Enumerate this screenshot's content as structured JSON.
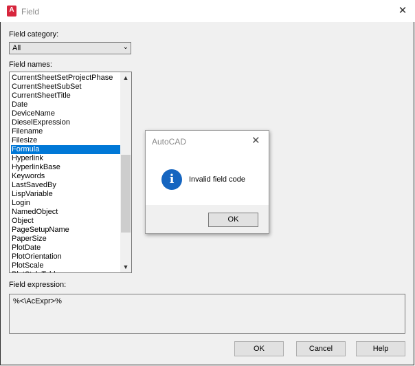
{
  "window": {
    "title": "Field",
    "app_icon_letter": "A"
  },
  "field_category": {
    "label": "Field category:",
    "selected": "All"
  },
  "field_names": {
    "label": "Field names:",
    "items": [
      "CurrentSheetSetProjectPhase",
      "CurrentSheetSubSet",
      "CurrentSheetTitle",
      "Date",
      "DeviceName",
      "DieselExpression",
      "Filename",
      "Filesize",
      "Formula",
      "Hyperlink",
      "HyperlinkBase",
      "Keywords",
      "LastSavedBy",
      "LispVariable",
      "Login",
      "NamedObject",
      "Object",
      "PageSetupName",
      "PaperSize",
      "PlotDate",
      "PlotOrientation",
      "PlotScale",
      "PlotStyleTable"
    ],
    "selected": "Formula"
  },
  "field_expression": {
    "label": "Field expression:",
    "value": "%<\\AcExpr>%"
  },
  "buttons": {
    "ok": "OK",
    "cancel": "Cancel",
    "help": "Help"
  },
  "message_box": {
    "title": "AutoCAD",
    "message": "Invalid field code",
    "ok": "OK",
    "icon": "information-icon"
  },
  "colors": {
    "selection": "#0078d7",
    "info_icon": "#1565c0",
    "app_icon": "#d7263d"
  }
}
